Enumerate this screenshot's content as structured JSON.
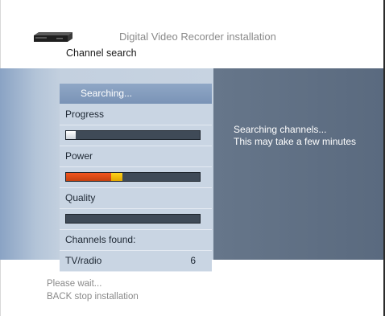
{
  "header": {
    "app_title": "Digital Video Recorder installation",
    "page_title": "Channel search"
  },
  "menu": {
    "selected_label": "Searching...",
    "progress_label": "Progress",
    "progress_level": 0.07,
    "power_label": "Power",
    "power_level": 0.42,
    "quality_label": "Quality",
    "quality_level": 0,
    "channels_label": "Channels found:",
    "tv_radio_label": "TV/radio",
    "tv_radio_count": "6"
  },
  "info": {
    "line1": "Searching channels...",
    "line2": "This may take a few minutes"
  },
  "footer": {
    "line1": "Please wait...",
    "line2": "BACK stop installation"
  },
  "colors": {
    "panel_dark": "#5f6f84",
    "menu_bg": "#c9d5e3",
    "selected_bg": "#8199bb",
    "bar_bg": "#3f4a57",
    "power_red": "#e44a17",
    "power_yellow": "#f5c400"
  },
  "icons": {
    "device": "dvr-device-icon"
  }
}
